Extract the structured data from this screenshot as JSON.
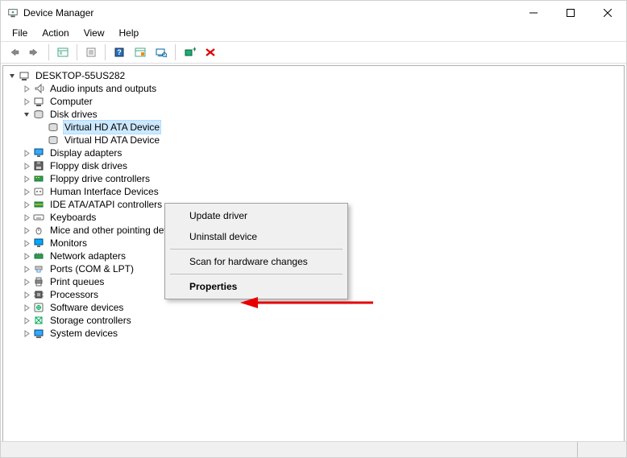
{
  "title": "Device Manager",
  "menubar": [
    "File",
    "Action",
    "View",
    "Help"
  ],
  "context_menu": {
    "items": [
      "Update driver",
      "Uninstall device",
      "Scan for hardware changes",
      "Properties"
    ]
  },
  "tree": {
    "root": "DESKTOP-55US282",
    "nodes": [
      {
        "label": "Audio inputs and outputs",
        "icon": "audio",
        "expandable": true,
        "depth": 1
      },
      {
        "label": "Computer",
        "icon": "computer",
        "expandable": true,
        "depth": 1
      },
      {
        "label": "Disk drives",
        "icon": "disk",
        "expandable": true,
        "expanded": true,
        "depth": 1
      },
      {
        "label": "Virtual HD ATA Device",
        "icon": "disk",
        "expandable": false,
        "depth": 2,
        "selected": true
      },
      {
        "label": "Virtual HD ATA Device",
        "icon": "disk",
        "expandable": false,
        "depth": 2
      },
      {
        "label": "Display adapters",
        "icon": "display",
        "expandable": true,
        "depth": 1
      },
      {
        "label": "Floppy disk drives",
        "icon": "floppy",
        "expandable": true,
        "depth": 1
      },
      {
        "label": "Floppy drive controllers",
        "icon": "floppyctrl",
        "expandable": true,
        "depth": 1
      },
      {
        "label": "Human Interface Devices",
        "icon": "hid",
        "expandable": true,
        "depth": 1
      },
      {
        "label": "IDE ATA/ATAPI controllers",
        "icon": "ide",
        "expandable": true,
        "depth": 1
      },
      {
        "label": "Keyboards",
        "icon": "keyboard",
        "expandable": true,
        "depth": 1
      },
      {
        "label": "Mice and other pointing devices",
        "icon": "mouse",
        "expandable": true,
        "depth": 1
      },
      {
        "label": "Monitors",
        "icon": "monitor",
        "expandable": true,
        "depth": 1
      },
      {
        "label": "Network adapters",
        "icon": "network",
        "expandable": true,
        "depth": 1
      },
      {
        "label": "Ports (COM & LPT)",
        "icon": "ports",
        "expandable": true,
        "depth": 1
      },
      {
        "label": "Print queues",
        "icon": "print",
        "expandable": true,
        "depth": 1
      },
      {
        "label": "Processors",
        "icon": "cpu",
        "expandable": true,
        "depth": 1
      },
      {
        "label": "Software devices",
        "icon": "software",
        "expandable": true,
        "depth": 1
      },
      {
        "label": "Storage controllers",
        "icon": "storage",
        "expandable": true,
        "depth": 1
      },
      {
        "label": "System devices",
        "icon": "system",
        "expandable": true,
        "depth": 1
      }
    ]
  }
}
